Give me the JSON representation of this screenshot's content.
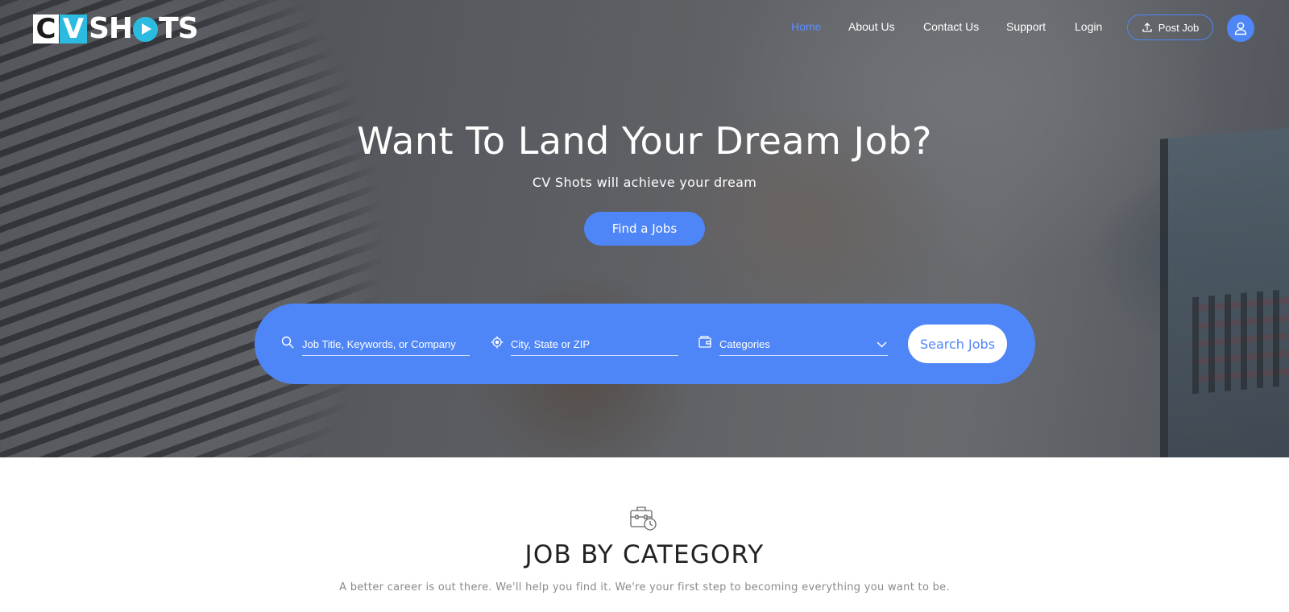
{
  "brand": {
    "logo_c": "C",
    "logo_v": "V",
    "logo_sh": "SH",
    "logo_ts": "TS"
  },
  "nav": {
    "items": [
      {
        "label": "Home",
        "active": true
      },
      {
        "label": "About Us",
        "active": false
      },
      {
        "label": "Contact Us",
        "active": false
      },
      {
        "label": "Support",
        "active": false
      },
      {
        "label": "Login",
        "active": false
      }
    ],
    "post_job_label": "Post Job",
    "post_job_icon": "upload-icon",
    "account_icon": "user-icon"
  },
  "hero": {
    "title": "Want To Land Your Dream Job?",
    "subtitle": "CV Shots will achieve your dream",
    "cta_label": "Find a Jobs"
  },
  "search": {
    "keyword_placeholder": "Job Title, Keywords, or Company",
    "keyword_icon": "search-icon",
    "location_placeholder": "City, State or ZIP",
    "location_icon": "location-target-icon",
    "category_selected": "Categories",
    "category_icon": "wallet-icon",
    "button_label": "Search Jobs"
  },
  "section": {
    "icon": "briefcase-clock-icon",
    "title": "JOB BY CATEGORY",
    "subtitle": "A better career is out there. We'll help you find it. We're your first step to becoming everything you want to be."
  },
  "colors": {
    "accent": "#4f86f7",
    "logo_cyan": "#2bbbe0",
    "active_nav": "#5b8dff"
  }
}
